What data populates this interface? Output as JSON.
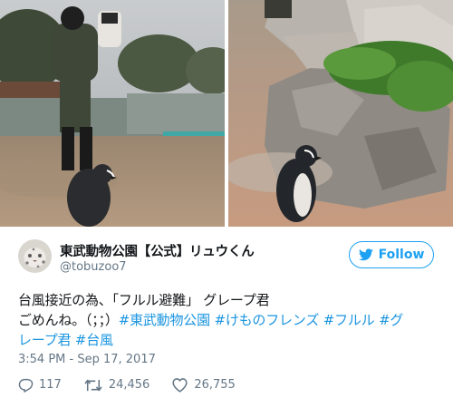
{
  "user": {
    "display_name": "東武動物公園【公式】リュウくん",
    "handle": "@tobuzoo7",
    "avatar_icon": "snow-leopard-avatar"
  },
  "follow_button": {
    "label": "Follow",
    "icon": "twitter-bird-icon",
    "color": "#1da1f2"
  },
  "tweet": {
    "line1": "台風接近の為、「フルル避難」 グレープ君",
    "line2_prefix": "ごめんね。（；；）",
    "hashtags_line2": [
      "#東武動物公園",
      "#けものフレンズ",
      "#フルル",
      "#グ"
    ],
    "line3_hashtags": [
      "レープ君",
      "#台風"
    ],
    "hashtag_color": "#1b95e0"
  },
  "timestamp": "3:54 PM - Sep 17, 2017",
  "stats": {
    "replies": "117",
    "retweets": "24,456",
    "likes": "26,755"
  },
  "media": {
    "left_photo_icon": "penguin-and-keeper-photo",
    "right_photo_icon": "penguin-by-rock-photo"
  }
}
